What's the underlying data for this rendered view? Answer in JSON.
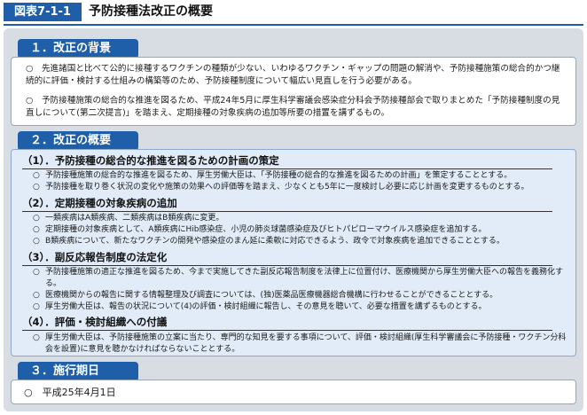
{
  "header": {
    "figure_label": "図表7-1-1",
    "title": "予防接種法改正の概要"
  },
  "sections": {
    "s1": {
      "heading": "１．改正の背景",
      "paragraphs": [
        "○　先進諸国と比べて公的に接種するワクチンの種類が少ない、いわゆるワクチン・ギャップの問題の解消や、予防接種施策の総合的かつ継続的に評価・検討する仕組みの構築等のため、予防接種制度について幅広い見直しを行う必要がある。",
        "○　予防接種施策の総合的な推進を図るため、平成24年5月に厚生科学審議会感染症分科会予防接種部会で取りまとめた「予防接種制度の見直しについて(第二次提言)」を踏まえ、定期接種の対象疾病の追加等所要の措置を講ずるもの。"
      ]
    },
    "s2": {
      "heading": "２．改正の概要",
      "subsections": [
        {
          "title": "（1）．予防接種の総合的な推進を図るための計画の策定",
          "items": [
            "予防接種施策の総合的な推進を図るため、厚生労働大臣は、「予防接種の総合的な推進を図るための計画」を策定することとする。",
            "予防接種を取り巻く状況の変化や施策の効果への評価等を踏まえ、少なくとも5年に一度検討し必要に応じ計画を変更するものとする。"
          ]
        },
        {
          "title": "（2）．定期接種の対象疾病の追加",
          "items": [
            "一類疾病はA類疾病、二類疾病はB類疾病に変更。",
            "定期接種の対象疾病として、A類疾病にHib感染症、小児の肺炎球菌感染症及びヒトパピローマウイルス感染症を追加する。",
            "B類疾病について、新たなワクチンの開発や感染症のまん延に柔軟に対応できるよう、政令で対象疾病を追加できることとする。"
          ]
        },
        {
          "title": "（3）．副反応報告制度の法定化",
          "items": [
            "予防接種施策の適正な推進を図るため、今まで実施してきた副反応報告制度を法律上に位置付け、医療機関から厚生労働大臣への報告を義務化する。",
            "医療機関からの報告に関する情報整理及び調査については、(独)医薬品医療機器総合機構に行わせることができることとする。",
            "厚生労働大臣は、報告の状況について(4)の評価・検討組織に報告し、その意見を聴いて、必要な措置を講ずるものとする。"
          ]
        },
        {
          "title": "（4）．評価・検討組織への付議",
          "items": [
            "厚生労働大臣は、予防接種施策の立案に当たり、専門的な知見を要する事項について、評価・検討組織(厚生科学審議会に予防接種・ワクチン分科会を設置)に意見を聴かなければならないこととする。"
          ]
        }
      ]
    },
    "s3": {
      "heading": "３．施行期日",
      "text": "○　平成25年4月1日"
    }
  },
  "bullet": "○",
  "colors": {
    "accent": "#1f5ea8",
    "panel_bg": "#d8dde3",
    "box_blue": "#e1ecf8"
  }
}
